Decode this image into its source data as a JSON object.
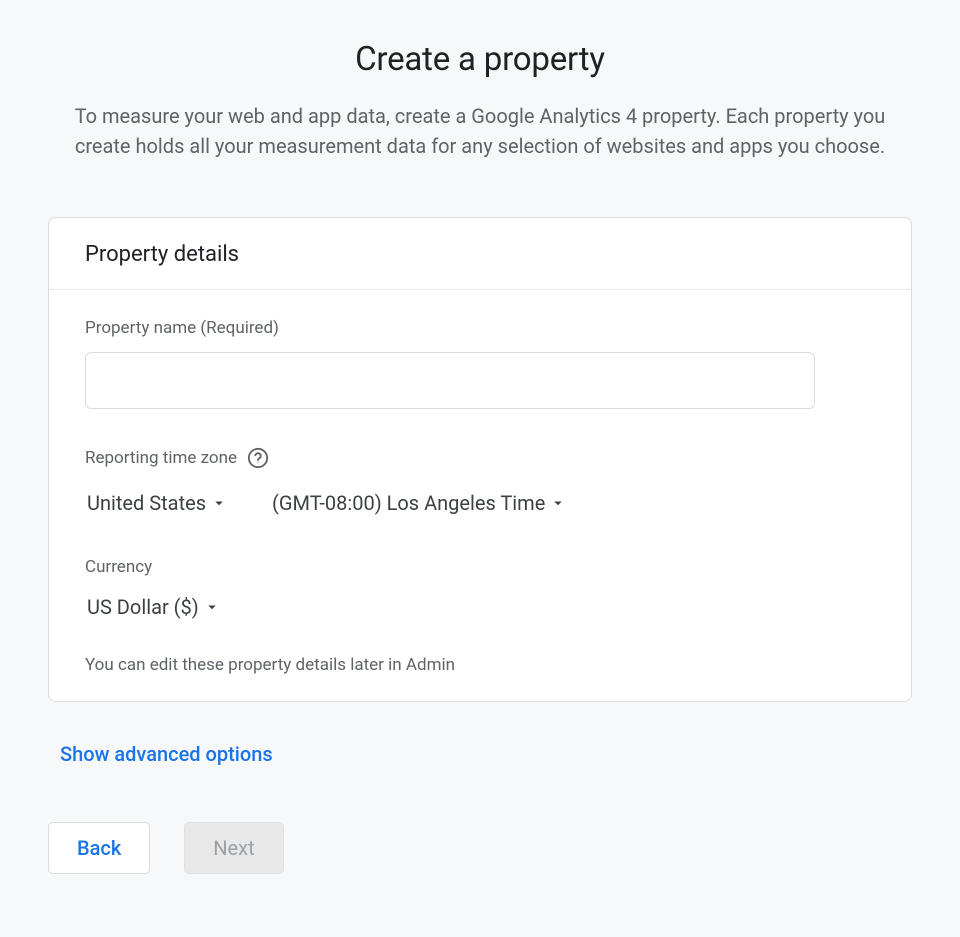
{
  "header": {
    "title": "Create a property",
    "subtitle": "To measure your web and app data, create a Google Analytics 4 property. Each property you create holds all your measurement data for any selection of websites and apps you choose."
  },
  "card": {
    "title": "Property details",
    "property_name": {
      "label": "Property name (Required)",
      "value": ""
    },
    "timezone": {
      "label": "Reporting time zone",
      "country_value": "United States",
      "tz_value": "(GMT-08:00) Los Angeles Time"
    },
    "currency": {
      "label": "Currency",
      "value": "US Dollar ($)"
    },
    "hint": "You can edit these property details later in Admin"
  },
  "advanced_link": "Show advanced options",
  "buttons": {
    "back": "Back",
    "next": "Next"
  }
}
